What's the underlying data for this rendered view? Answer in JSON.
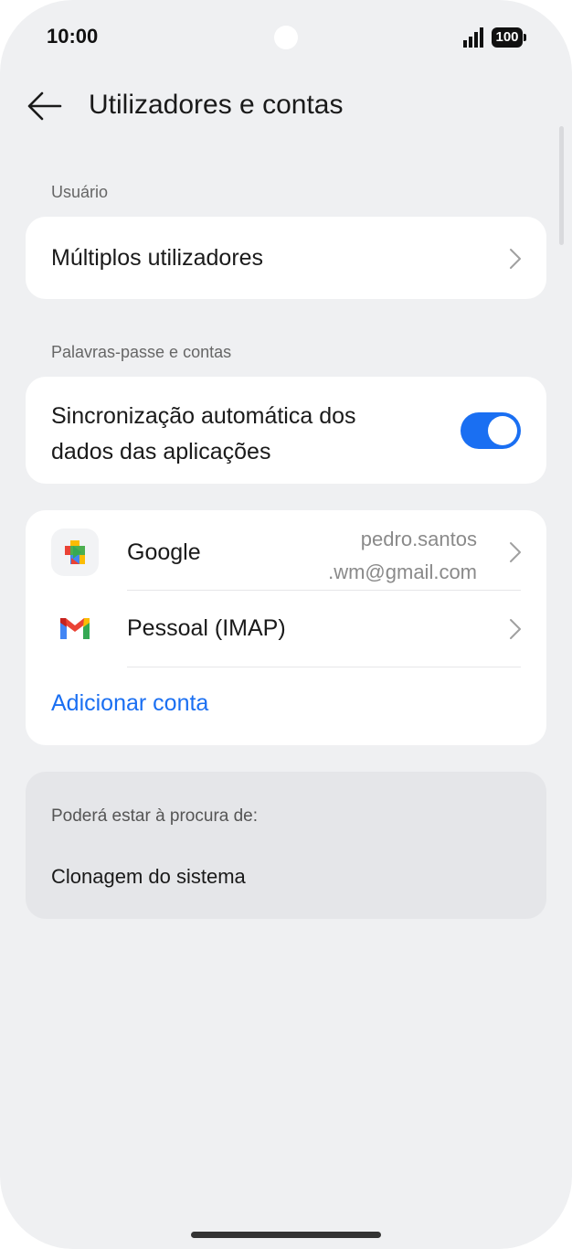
{
  "status_bar": {
    "time": "10:00",
    "battery": "100"
  },
  "header": {
    "title": "Utilizadores e contas"
  },
  "sections": {
    "user_label": "Usuário",
    "multiple_users": "Múltiplos utilizadores",
    "passwords_label": "Palavras-passe e contas",
    "auto_sync_line1": "Sincronização automática dos",
    "auto_sync_line2": "dados das aplicações",
    "auto_sync_on": true
  },
  "accounts": {
    "google_name": "Google",
    "google_email_line1": "pedro.santos",
    "google_email_line2": ".wm@gmail.com",
    "imap_name": "Pessoal (IMAP)",
    "add_account": "Adicionar conta"
  },
  "suggestions": {
    "label": "Poderá estar à procura de:",
    "item": "Clonagem do sistema"
  },
  "colors": {
    "accent": "#1a6ff2",
    "background": "#eff0f2"
  }
}
